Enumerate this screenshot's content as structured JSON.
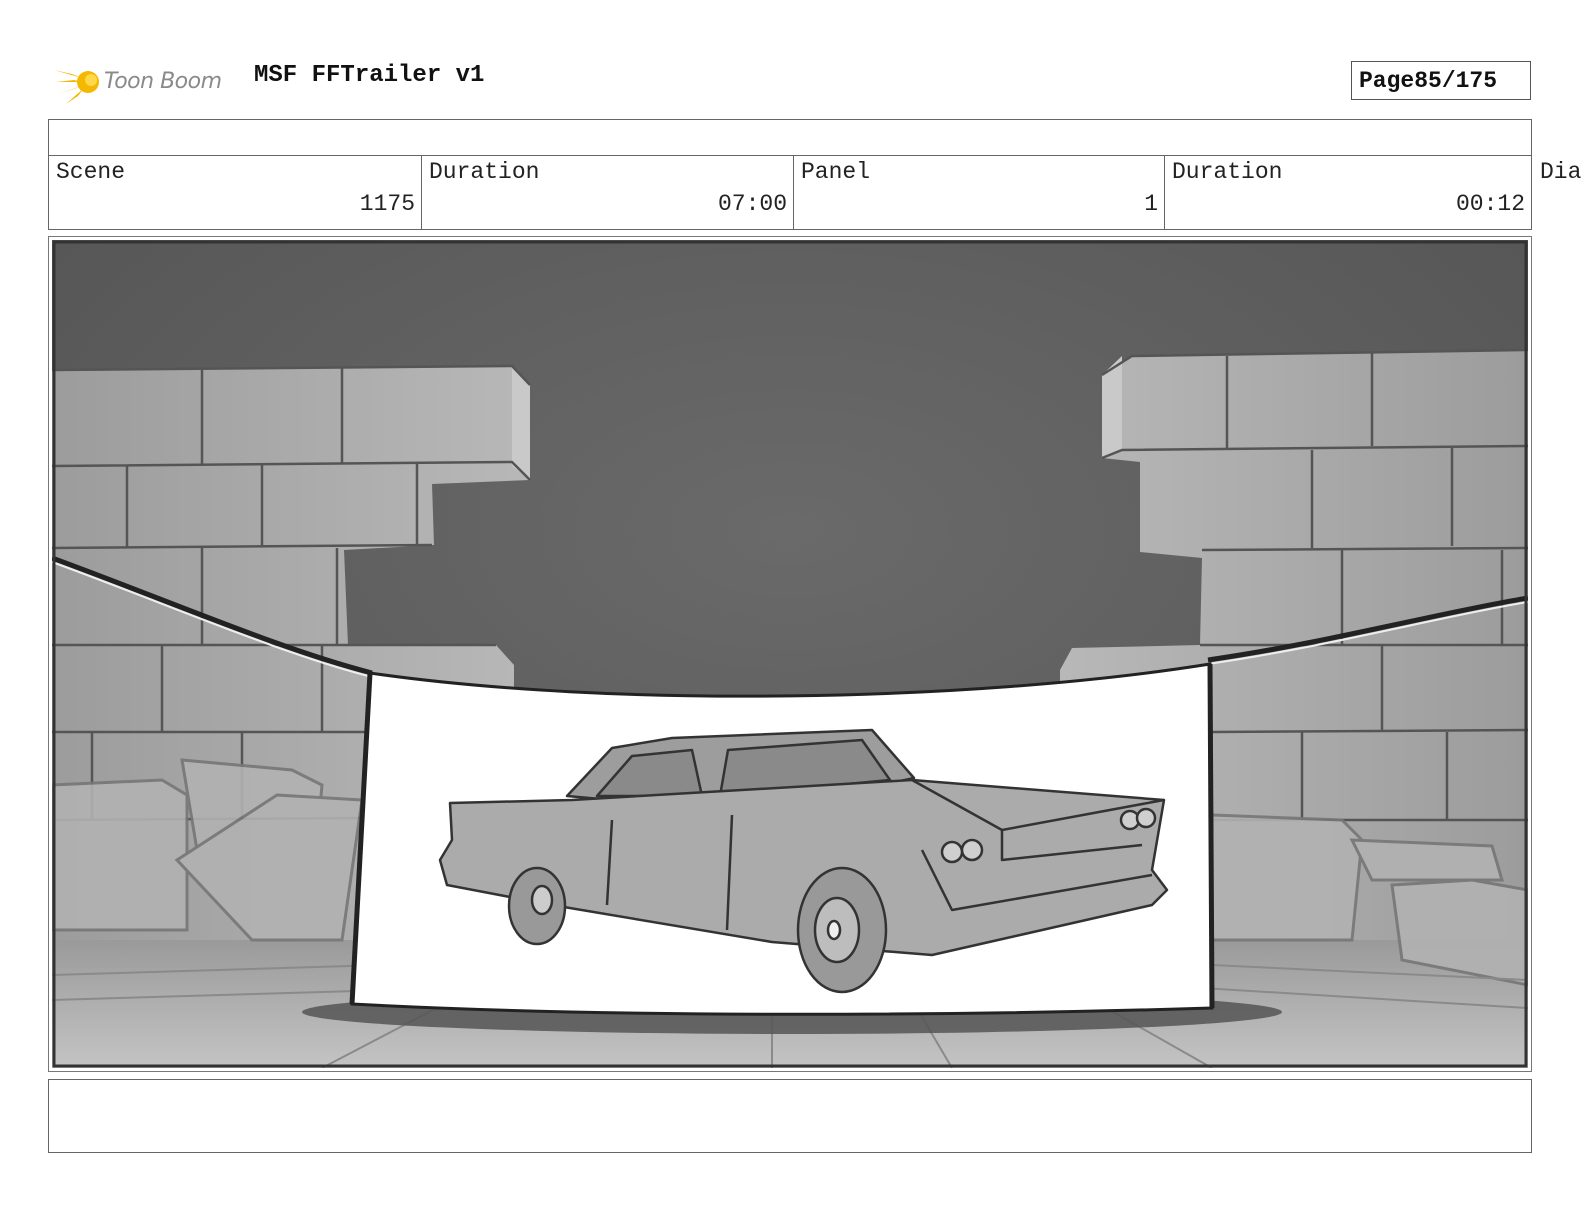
{
  "header": {
    "logo_text": "Toon Boom",
    "project_title": "MSF FFTrailer v1",
    "page_label": "Page",
    "page_number": "85/175"
  },
  "info": {
    "scene_label": "Scene",
    "scene_value": "1175",
    "scene_duration_label": "Duration",
    "scene_duration_value": "07:00",
    "panel_label": "Panel",
    "panel_value": "1",
    "panel_duration_label": "Duration",
    "panel_duration_value": "00:12",
    "dialogue_label": "Dia"
  },
  "colors": {
    "logo_star": "#f5b800",
    "sky": "#5e5e5e",
    "wall": "#a6a6a6",
    "banner": "#ffffff",
    "car": "#a9a9a9"
  },
  "icons": {
    "logo": "toon-boom-star-icon"
  }
}
